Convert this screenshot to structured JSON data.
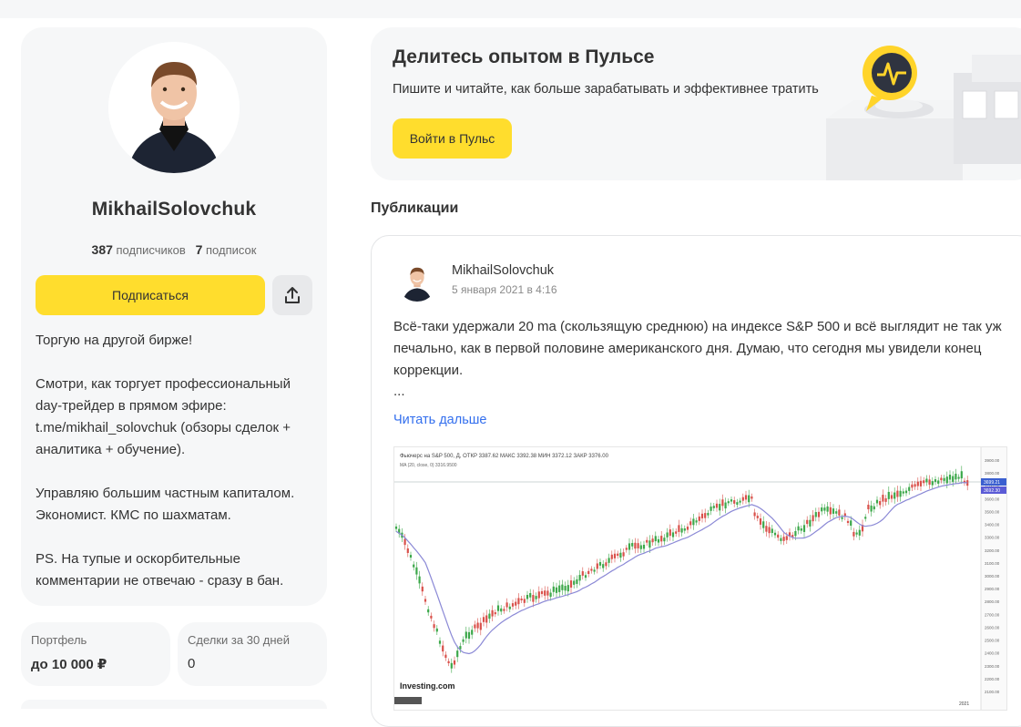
{
  "profile": {
    "username": "MikhailSolovchuk",
    "followers_count": "387",
    "followers_label": "подписчиков",
    "following_count": "7",
    "following_label": "подписок",
    "subscribe_label": "Подписаться",
    "bio": "Торгую на другой бирже!\n\nСмотри, как торгует профессиональный day-трейдер в прямом эфире: t.me/mikhail_solovchuk (обзоры сделок + аналитика + обучение).\n\nУправляю большим частным капиталом. Экономист. КМС по шахматам.\n\nPS. На тупые и оскорбительные комментарии не отвечаю - сразу в бан."
  },
  "stats": [
    {
      "label": "Портфель",
      "value": "до 10 000 ₽"
    },
    {
      "label": "Сделки за 30 дней",
      "value": "0"
    }
  ],
  "pulse_banner": {
    "title": "Делитесь опытом в Пульсе",
    "subtitle": "Пишите и читайте, как больше зарабатывать и эффективнее тратить",
    "button_label": "Войти в Пульс"
  },
  "publications": {
    "section_title": "Публикации",
    "post": {
      "author": "MikhailSolovchuk",
      "date": "5 января 2021 в 4:16",
      "text": "Всё-таки удержали 20 ma (скользящую среднюю) на индексе S&P 500 и всё выглядит не так уж печально, как в первой половине американского дня. Думаю, что сегодня мы увидели конец коррекции.",
      "ellipsis": "...",
      "read_more": "Читать дальше",
      "chart_header": "Фьючерс на S&P 500, Д,  ОТКР 3387.62  МАКС 3392.38  МИН 3372.12  ЗАКР 3376.00",
      "chart_ma_label": "MA (20, close, 0)   3316.9500",
      "chart_logo": "Investing.com",
      "y_ticks": [
        "3900.00",
        "3800.00",
        "3700.00",
        "3600.00",
        "3500.00",
        "3400.00",
        "3300.00",
        "3200.00",
        "3100.00",
        "3000.00",
        "2900.00",
        "2800.00",
        "2700.00",
        "2600.00",
        "2500.00",
        "2400.00",
        "2300.00",
        "2200.00",
        "2100.00"
      ],
      "price_tag_1": "3699.21",
      "price_tag_2": "3692.30",
      "x_label_right": "2021"
    }
  },
  "colors": {
    "accent_yellow": "#ffdd2d",
    "link_blue": "#336fee",
    "candle_up": "#3ca84a",
    "candle_down": "#d9504a",
    "ma_line": "#8b89d6"
  }
}
